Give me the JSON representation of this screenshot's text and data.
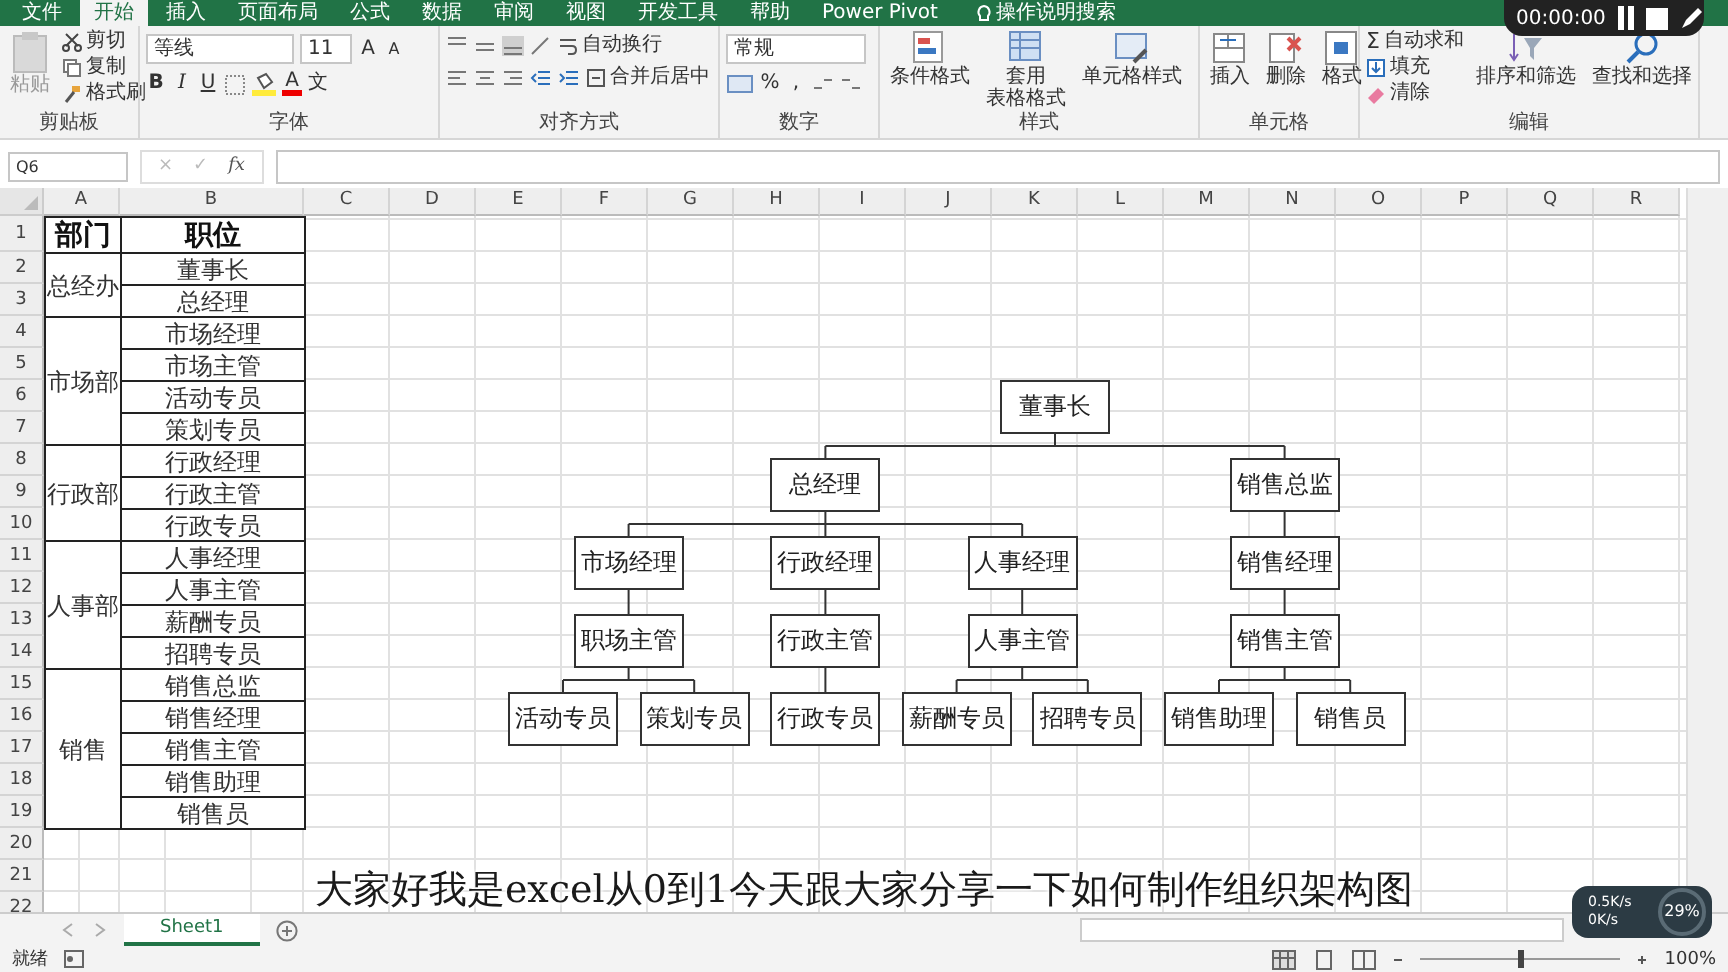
{
  "ribbon_tabs": [
    {
      "label": "文件",
      "selected": false
    },
    {
      "label": "开始",
      "selected": true
    },
    {
      "label": "插入",
      "selected": false
    },
    {
      "label": "页面布局",
      "selected": false
    },
    {
      "label": "公式",
      "selected": false
    },
    {
      "label": "数据",
      "selected": false
    },
    {
      "label": "审阅",
      "selected": false
    },
    {
      "label": "视图",
      "selected": false
    },
    {
      "label": "开发工具",
      "selected": false
    },
    {
      "label": "帮助",
      "selected": false
    },
    {
      "label": "Power Pivot",
      "selected": false
    }
  ],
  "tell_me": "操作说明搜索",
  "recorder": {
    "time": "00:00:00"
  },
  "clipboard": {
    "paste": "粘贴",
    "cut": "剪切",
    "copy": "复制",
    "format_painter": "格式刷",
    "title": "剪贴板"
  },
  "font": {
    "font_name": "等线",
    "font_size": "11",
    "grow": "A",
    "shrink": "A",
    "bold": "B",
    "italic": "I",
    "underline": "U",
    "font_color": "A",
    "phonetic": "文",
    "title": "字体"
  },
  "alignment": {
    "wrap": "自动换行",
    "merge": "合并后居中",
    "title": "对齐方式"
  },
  "number": {
    "format": "常规",
    "percent": "%",
    "comma": ",",
    "title": "数字"
  },
  "styles": {
    "conditional": "条件格式",
    "table_line1": "套用",
    "table_line2": "表格格式",
    "cell_styles": "单元格样式",
    "title": "样式"
  },
  "cells": {
    "insert": "插入",
    "delete": "删除",
    "format": "格式",
    "title": "单元格"
  },
  "editing": {
    "sum_symbol": "Σ",
    "autosum": "自动求和",
    "fill": "填充",
    "clear": "清除",
    "sort": "排序和筛选",
    "find": "查找和选择",
    "title": "编辑"
  },
  "formula_bar": {
    "name_box": "Q6",
    "cancel": "×",
    "enter": "✓",
    "fx": "fx"
  },
  "columns": [
    "A",
    "B",
    "C",
    "D",
    "E",
    "F",
    "G",
    "H",
    "I",
    "J",
    "K",
    "L",
    "M",
    "N",
    "O",
    "P",
    "Q",
    "R"
  ],
  "rows": [
    "1",
    "2",
    "3",
    "4",
    "5",
    "6",
    "7",
    "8",
    "9",
    "10",
    "11",
    "12",
    "13",
    "14",
    "15",
    "16",
    "17",
    "18",
    "19",
    "20",
    "21",
    "22"
  ],
  "table": {
    "headers": [
      "部门",
      "职位"
    ],
    "groups": [
      {
        "department": "总经办",
        "positions": [
          "董事长",
          "总经理"
        ]
      },
      {
        "department": "市场部",
        "positions": [
          "市场经理",
          "市场主管",
          "活动专员",
          "策划专员"
        ]
      },
      {
        "department": "行政部",
        "positions": [
          "行政经理",
          "行政主管",
          "行政专员"
        ]
      },
      {
        "department": "人事部",
        "positions": [
          "人事经理",
          "人事主管",
          "薪酬专员",
          "招聘专员"
        ]
      },
      {
        "department": "销售",
        "positions": [
          "销售总监",
          "销售经理",
          "销售主管",
          "销售助理",
          "销售员"
        ]
      }
    ]
  },
  "org_chart": {
    "label": "董事长",
    "children": [
      {
        "label": "总经理",
        "children": [
          {
            "label": "市场经理",
            "children": [
              {
                "label": "职场主管",
                "children": [
                  {
                    "label": "活动专员"
                  },
                  {
                    "label": "策划专员"
                  }
                ]
              }
            ]
          },
          {
            "label": "行政经理",
            "children": [
              {
                "label": "行政主管",
                "children": [
                  {
                    "label": "行政专员"
                  }
                ]
              }
            ]
          },
          {
            "label": "人事经理",
            "children": [
              {
                "label": "人事主管",
                "children": [
                  {
                    "label": "薪酬专员"
                  },
                  {
                    "label": "招聘专员"
                  }
                ]
              }
            ]
          }
        ]
      },
      {
        "label": "销售总监",
        "children": [
          {
            "label": "销售经理",
            "children": [
              {
                "label": "销售主管",
                "children": [
                  {
                    "label": "销售助理"
                  },
                  {
                    "label": "销售员"
                  }
                ]
              }
            ]
          }
        ]
      }
    ]
  },
  "subtitle": "大家好我是excel从0到1今天跟大家分享一下如何制作组织架构图",
  "network_monitor": {
    "upload": "0.5K/s",
    "download": "0K/s",
    "usage": "29%"
  },
  "sheet_tabs": [
    {
      "label": "Sheet1",
      "selected": true
    }
  ],
  "status_bar": {
    "ready": "就绪",
    "zoom": "100%",
    "zoom_slider": {
      "level": 0.5
    }
  }
}
